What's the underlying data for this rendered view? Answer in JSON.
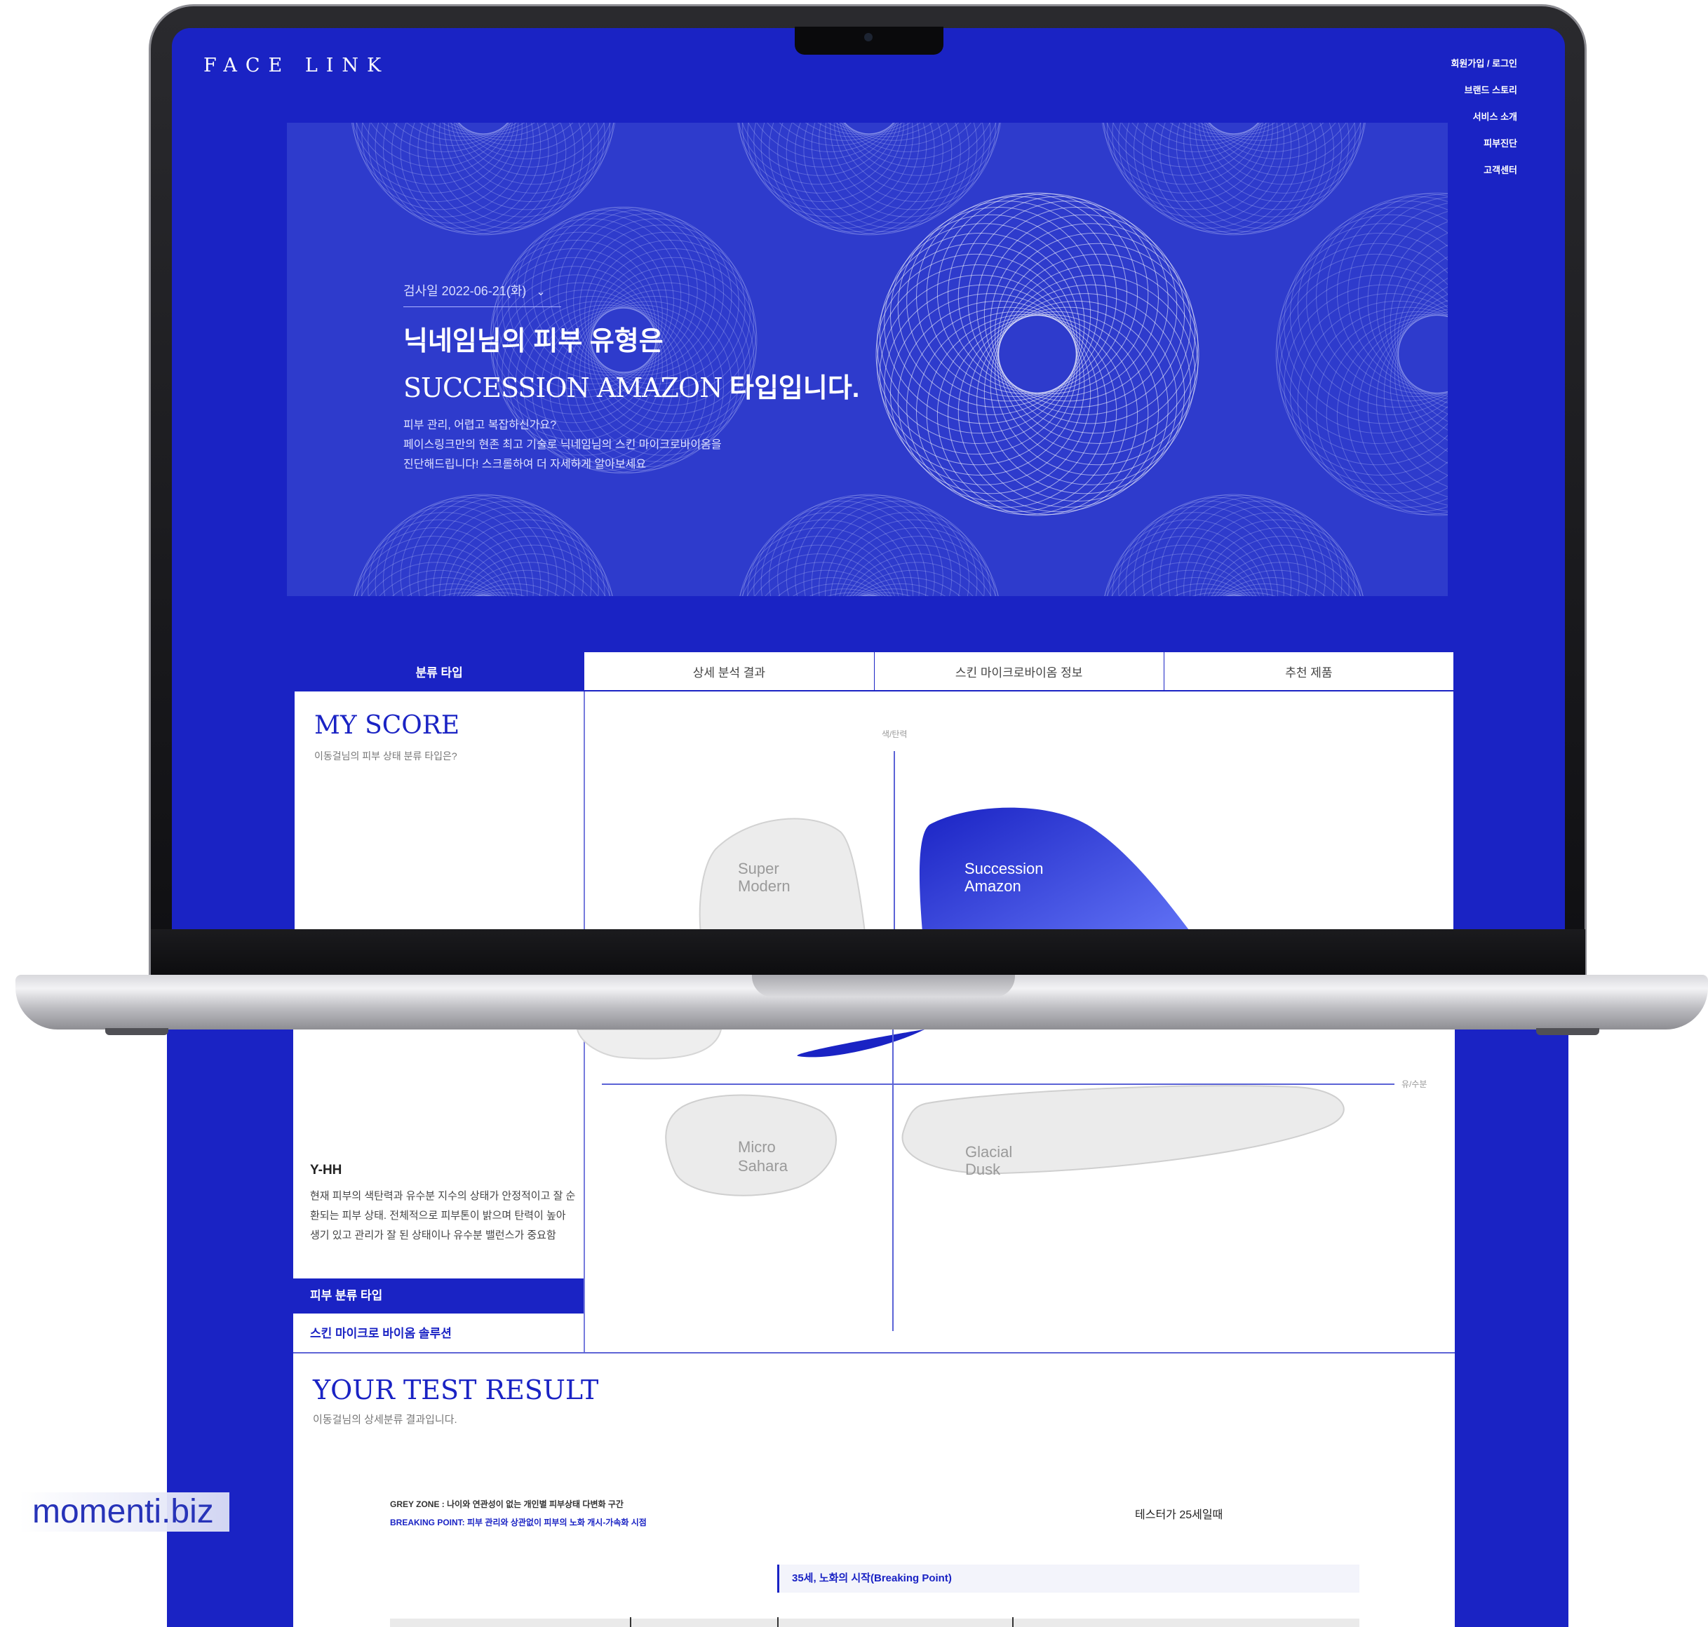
{
  "brand": {
    "logo": "FACE LINK",
    "accent": "#1a23c4",
    "accent_light": "#5a68f0"
  },
  "nav": {
    "items": [
      "회원가입 / 로그인",
      "브랜드 스토리",
      "서비스 소개",
      "피부진단",
      "고객센터"
    ]
  },
  "hero": {
    "date_label": "검사일 2022-06-21(화)",
    "title_line1": "닉네임님의 피부 유형은",
    "title_type": "SUCCESSION AMAZON",
    "title_suffix": " 타입입니다.",
    "desc": [
      "피부 관리, 어렵고 복잡하신가요?",
      "페이스링크만의 현존 최고 기술로 닉네임님의 스킨 마이크로바이옴을",
      "진단해드립니다! 스크롤하여 더 자세하게 알아보세요"
    ]
  },
  "tabs": [
    "분류 타입",
    "상세 분석 결과",
    "스킨 마이크로바이옴 정보",
    "추천 제품"
  ],
  "my_score": {
    "title": "MY SCORE",
    "subtitle": "이동걸님의 피부 상태 분류 타입은?",
    "y_axis": "색/탄력",
    "x_axis": "유/수분",
    "quadrants": {
      "super_modern": [
        "Super",
        "Modern"
      ],
      "succession_amazon": [
        "Succession",
        "Amazon"
      ],
      "micro_sahara": [
        "Micro",
        "Sahara"
      ],
      "glacial_dusk": [
        "Glacial",
        "Dusk"
      ]
    },
    "type_code": "Y-HH",
    "type_desc": "현재 피부의 색탄력과 유수분 지수의 상태가 안정적이고 잘 순환되는 피부 상태. 전체적으로 피부톤이 밝으며 탄력이 높아 생기 있고 관리가 잘 된 상태이나 유수분 밸런스가 중요함",
    "side_menu": [
      "피부 분류 타입",
      "스킨 마이크로 바이옴 솔루션"
    ]
  },
  "test_result": {
    "title": "YOUR TEST RESULT",
    "subtitle": "이동걸님의 상세분류 결과입니다.",
    "grey_zone": "GREY ZONE : 나이와 연관성이 없는 개인별 피부상태 다변화 구간",
    "breaking_point": "BREAKING POINT: 피부 관리와 상관없이 피부의 노화 개시-가속화 시점",
    "age_note": "테스터가 25세일때",
    "bp_label": "35세, 노화의 시작(Breaking Point)"
  },
  "watermark": "momenti.biz"
}
